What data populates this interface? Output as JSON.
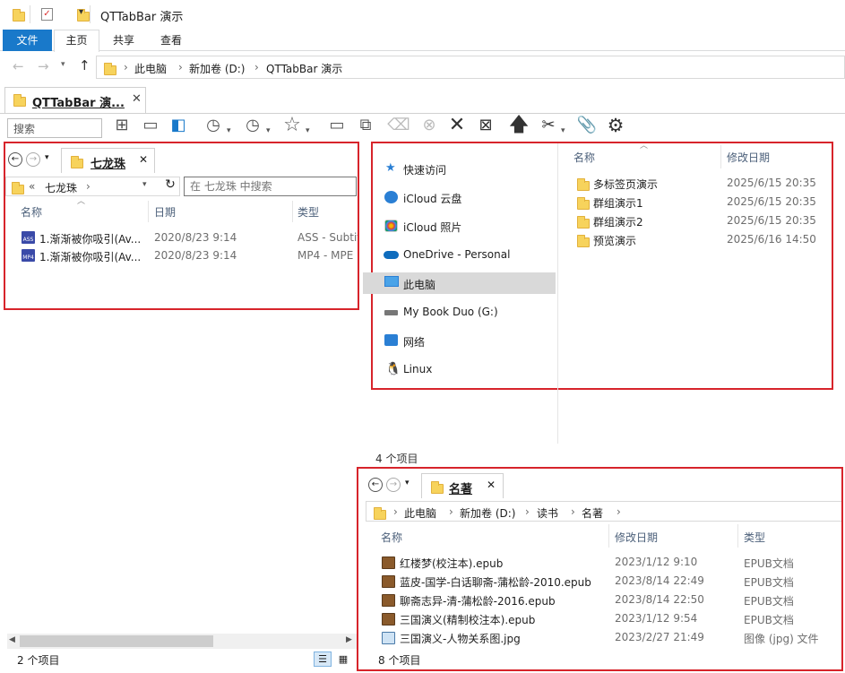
{
  "window": {
    "title": "QTTabBar 演示"
  },
  "ribbon": {
    "tabs": [
      "文件",
      "主页",
      "共享",
      "查看"
    ]
  },
  "address": {
    "crumbs": [
      "此电脑",
      "新加卷 (D:)",
      "QTTabBar 演示"
    ]
  },
  "main_tab": {
    "label": "QTTabBar 演..."
  },
  "left_pane": {
    "tab_label": "七龙珠",
    "path": [
      "«",
      "七龙珠"
    ],
    "search_placeholder": "在 七龙珠 中搜索",
    "columns": [
      "名称",
      "日期",
      "类型"
    ],
    "files": [
      {
        "name": "1.渐渐被你吸引(Av...",
        "date": "2020/8/23 9:14",
        "type": "ASS - Subtit",
        "icon": "ass-file-icon"
      },
      {
        "name": "1.渐渐被你吸引(Av...",
        "date": "2020/8/23 9:14",
        "type": "MP4 - MPE",
        "icon": "mp4-file-icon"
      }
    ],
    "status": "2 个项目"
  },
  "nav_pane": {
    "items": [
      {
        "label": "快速访问",
        "icon": "star-icon"
      },
      {
        "label": "iCloud 云盘",
        "icon": "icloud-icon"
      },
      {
        "label": "iCloud 照片",
        "icon": "photos-icon"
      },
      {
        "label": "OneDrive - Personal",
        "icon": "onedrive-icon"
      },
      {
        "label": "此电脑",
        "icon": "computer-icon",
        "selected": true
      },
      {
        "label": "My Book Duo (G:)",
        "icon": "drive-icon"
      },
      {
        "label": "网络",
        "icon": "network-icon"
      },
      {
        "label": "Linux",
        "icon": "linux-icon"
      }
    ]
  },
  "content_pane": {
    "columns": [
      "名称",
      "修改日期"
    ],
    "folders": [
      {
        "name": "多标签页演示",
        "date": "2025/6/15 20:35"
      },
      {
        "name": "群组演示1",
        "date": "2025/6/15 20:35"
      },
      {
        "name": "群组演示2",
        "date": "2025/6/15 20:35"
      },
      {
        "name": "预览演示",
        "date": "2025/6/16 14:50"
      }
    ],
    "status": "4 个项目"
  },
  "bottom_pane": {
    "tab_label": "名著",
    "path": [
      "此电脑",
      "新加卷 (D:)",
      "读书",
      "名著"
    ],
    "columns": [
      "名称",
      "修改日期",
      "类型"
    ],
    "files": [
      {
        "name": "红楼梦(校注本).epub",
        "date": "2023/1/12 9:10",
        "type": "EPUB文档",
        "icon": "epub-icon"
      },
      {
        "name": "蓝皮-国学-白话聊斋-蒲松龄-2010.epub",
        "date": "2023/8/14 22:49",
        "type": "EPUB文档",
        "icon": "epub-icon"
      },
      {
        "name": "聊斋志异-清-蒲松龄-2016.epub",
        "date": "2023/8/14 22:50",
        "type": "EPUB文档",
        "icon": "epub-icon"
      },
      {
        "name": "三国演义(精制校注本).epub",
        "date": "2023/1/12 9:54",
        "type": "EPUB文档",
        "icon": "epub-icon"
      },
      {
        "name": "三国演义-人物关系图.jpg",
        "date": "2023/2/27 21:49",
        "type": "图像 (jpg) 文件",
        "icon": "image-icon"
      }
    ],
    "status": "8 个项目"
  },
  "colors": {
    "accent": "#1979ca",
    "highlight_red": "#d7242b",
    "selected_nav": "#d9d9d9"
  }
}
